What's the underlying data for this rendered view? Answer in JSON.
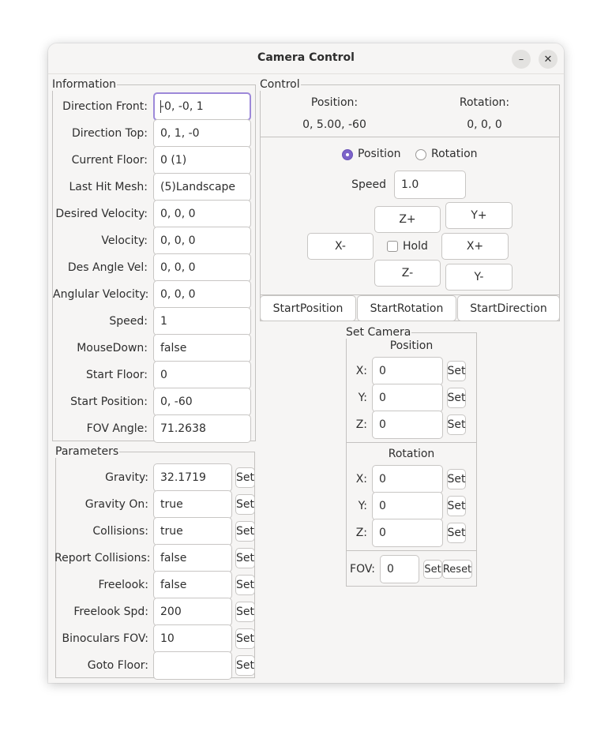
{
  "window": {
    "title": "Camera Control",
    "minimize_glyph": "–",
    "close_glyph": "✕"
  },
  "information": {
    "legend": "Information",
    "rows": [
      {
        "label": "Direction Front:",
        "value": "-0, -0, 1"
      },
      {
        "label": "Direction Top:",
        "value": "0, 1, -0"
      },
      {
        "label": "Current Floor:",
        "value": "0 (1)"
      },
      {
        "label": "Last Hit Mesh:",
        "value": "(5)Landscape"
      },
      {
        "label": "Desired Velocity:",
        "value": "0, 0, 0"
      },
      {
        "label": "Velocity:",
        "value": "0, 0, 0"
      },
      {
        "label": "Des Angle Vel:",
        "value": "0, 0, 0"
      },
      {
        "label": "Anglular Velocity:",
        "value": "0, 0, 0"
      },
      {
        "label": "Speed:",
        "value": "1"
      },
      {
        "label": "MouseDown:",
        "value": "false"
      },
      {
        "label": "Start Floor:",
        "value": "0"
      },
      {
        "label": "Start Position:",
        "value": "0, -60"
      },
      {
        "label": "FOV Angle:",
        "value": "71.2638"
      }
    ]
  },
  "parameters": {
    "legend": "Parameters",
    "set_label": "Set",
    "rows": [
      {
        "label": "Gravity:",
        "value": "32.1719"
      },
      {
        "label": "Gravity On:",
        "value": "true"
      },
      {
        "label": "Collisions:",
        "value": "true"
      },
      {
        "label": "Report Collisions:",
        "value": "false"
      },
      {
        "label": "Freelook:",
        "value": "false"
      },
      {
        "label": "Freelook Spd:",
        "value": "200"
      },
      {
        "label": "Binoculars FOV:",
        "value": "10"
      },
      {
        "label": "Goto Floor:",
        "value": ""
      }
    ]
  },
  "control": {
    "legend": "Control",
    "position_title": "Position:",
    "position_value": "0, 5.00, -60",
    "rotation_title": "Rotation:",
    "rotation_value": "0, 0, 0",
    "radio_position": "Position",
    "radio_rotation": "Rotation",
    "mode_selected": "Position",
    "speed_label": "Speed",
    "speed_value": "1.0",
    "btn_zplus": "Z+",
    "btn_yplus": "Y+",
    "btn_xminus": "X-",
    "hold_label": "Hold",
    "hold_checked": false,
    "btn_xplus": "X+",
    "btn_zminus": "Z-",
    "btn_yminus": "Y-",
    "start_position": "StartPosition",
    "start_rotation": "StartRotation",
    "start_direction": "StartDirection"
  },
  "set_camera": {
    "legend": "Set Camera",
    "position_title": "Position",
    "rotation_title": "Rotation",
    "set_label": "Set",
    "position_rows": [
      {
        "label": "X:",
        "value": "0"
      },
      {
        "label": "Y:",
        "value": "0"
      },
      {
        "label": "Z:",
        "value": "0"
      }
    ],
    "rotation_rows": [
      {
        "label": "X:",
        "value": "0"
      },
      {
        "label": "Y:",
        "value": "0"
      },
      {
        "label": "Z:",
        "value": "0"
      }
    ],
    "fov_label": "FOV:",
    "fov_value": "0",
    "reset_label": "Reset"
  }
}
